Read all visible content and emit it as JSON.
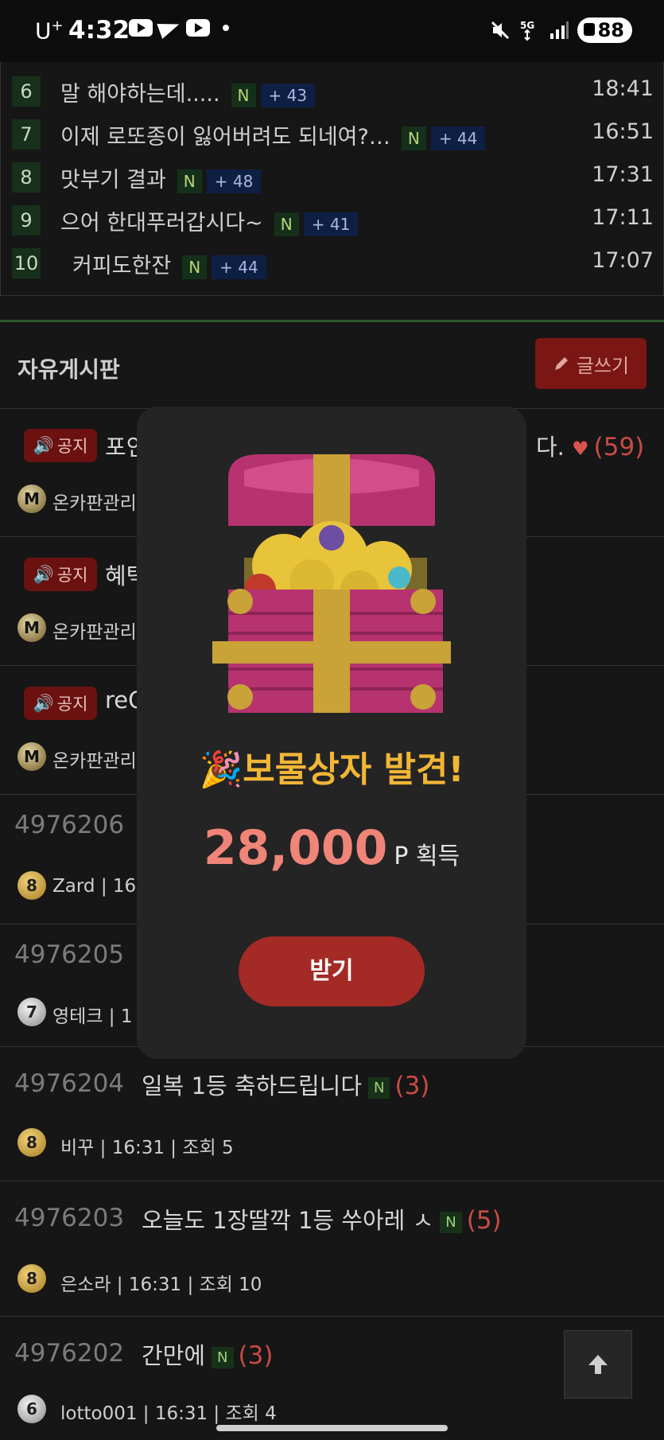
{
  "status_bar": {
    "carrier": "U",
    "carrier_sup": "+",
    "time": "4:32",
    "battery": "88"
  },
  "top_list": [
    {
      "rank": "6",
      "title": "말 해야하는데.....",
      "new": "N",
      "comments": "+ 43",
      "time": "18:41"
    },
    {
      "rank": "7",
      "title": "이제 로또종이 잃어버려도 되네여?…",
      "new": "N",
      "comments": "+ 44",
      "time": "16:51"
    },
    {
      "rank": "8",
      "title": "맛부기 결과",
      "new": "N",
      "comments": "+ 48",
      "time": "17:31"
    },
    {
      "rank": "9",
      "title": "으어 한대푸러갑시다~",
      "new": "N",
      "comments": "+ 41",
      "time": "17:11"
    },
    {
      "rank": "10",
      "title": "커피도한잔",
      "new": "N",
      "comments": "+ 44",
      "time": "17:07"
    }
  ],
  "board": {
    "title": "자유게시판",
    "write_label": "글쓰기"
  },
  "notices": [
    {
      "badge": "공지",
      "title": "포인",
      "tail": "다.",
      "likes": "(59)",
      "author": "온카판관리"
    },
    {
      "badge": "공지",
      "title": "혜택",
      "author": "온카판관리"
    },
    {
      "badge": "공지",
      "title": "reC",
      "author": "온카판관리"
    }
  ],
  "posts": [
    {
      "id": "4976206",
      "title": "",
      "level": "8",
      "meta": "Zard | 16"
    },
    {
      "id": "4976205",
      "title": "",
      "level": "7",
      "meta": "영테크 | 1"
    },
    {
      "id": "4976204",
      "title": "일복 1등 축하드립니다",
      "new": "N",
      "comments": "(3)",
      "level": "8",
      "meta": "비꾸 | 16:31 | 조회 5"
    },
    {
      "id": "4976203",
      "title": "오늘도 1장딸깍 1등 쑤아레 ㅅ",
      "new": "N",
      "comments": "(5)",
      "level": "8",
      "meta": "은소라 | 16:31 | 조회 10"
    },
    {
      "id": "4976202",
      "title": "간만에",
      "new": "N",
      "comments": "(3)",
      "level": "6",
      "meta": "lotto001 | 16:31 | 조회 4"
    }
  ],
  "modal": {
    "title": "보물상자 발견!",
    "amount": "28,000",
    "unit": "P 획득",
    "button": "받기"
  },
  "colors": {
    "accent_red": "#a42a25",
    "gold": "#f2b636",
    "amount": "#ef8478"
  }
}
